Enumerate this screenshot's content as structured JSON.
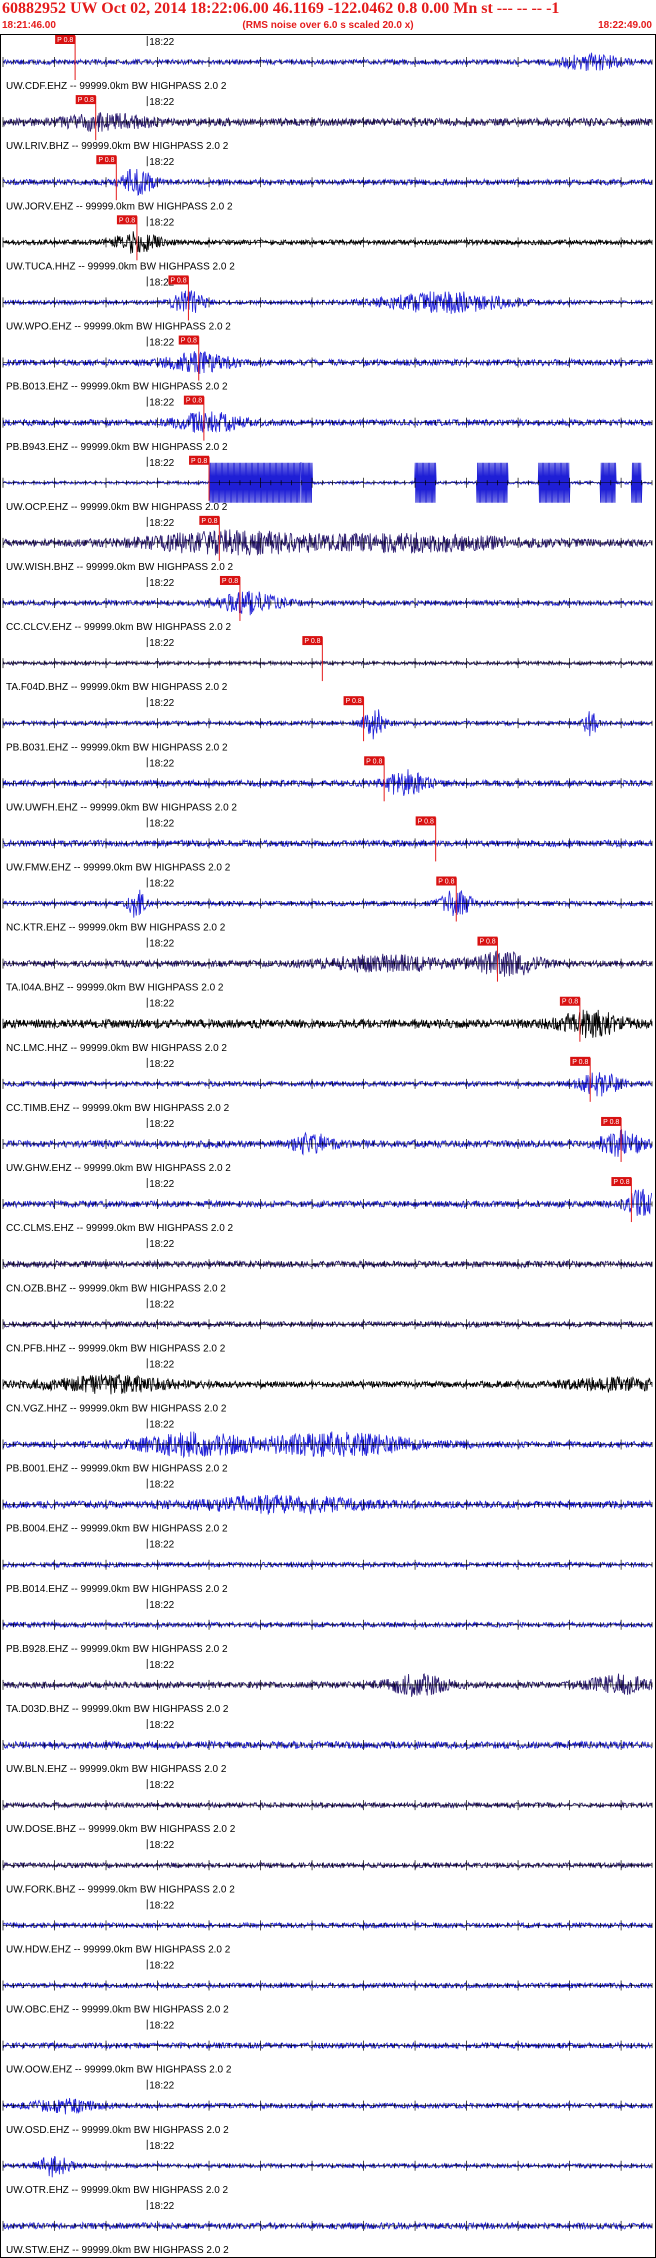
{
  "header": {
    "title": "60882952 UW Oct 02, 2014 18:22:06.00   46.1169 -122.0462  0.8 0.00 Mn st --- -- --  -1",
    "start_time": "18:21:46.00",
    "scale_note": "(RMS noise over 6.0 s scaled 20.0 x)",
    "end_time": "18:22:49.00"
  },
  "chart_data": {
    "type": "line",
    "time_start": "18:21:46.00",
    "time_end": "18:22:49.00",
    "minute_label": "18:22",
    "grid": false,
    "traces": [
      {
        "label": "UW.CDF.EHZ -- 99999.0km BW  HIGHPASS  2.0  2",
        "color": "#1f1fd6",
        "pick": "18:21:53.0",
        "pick_label": "P 0.8",
        "amp": 0.35,
        "bursts": [
          {
            "t": 57,
            "a": 1.0,
            "w": 3
          }
        ]
      },
      {
        "label": "UW.LRIV.BHZ -- 99999.0km BW  HIGHPASS  2.0  2",
        "color": "#2a1a6e",
        "pick": "18:21:55.0",
        "pick_label": "P 0.8",
        "amp": 0.55,
        "bursts": [
          {
            "t": 10,
            "a": 0.9,
            "w": 4
          }
        ]
      },
      {
        "label": "UW.JORV.EHZ -- 99999.0km BW  HIGHPASS  2.0  2",
        "color": "#1f1fd6",
        "pick": "18:21:57.0",
        "pick_label": "P 0.8",
        "amp": 0.4,
        "bursts": [
          {
            "t": 13,
            "a": 1.8,
            "w": 1.5
          }
        ]
      },
      {
        "label": "UW.TUCA.HHZ -- 99999.0km BW  HIGHPASS  2.0  2",
        "color": "#000000",
        "pick": "18:21:59.0",
        "pick_label": "P 0.8",
        "amp": 0.35,
        "bursts": [
          {
            "t": 13,
            "a": 1.5,
            "w": 2
          }
        ]
      },
      {
        "label": "UW.WPO.EHZ -- 99999.0km BW  HIGHPASS  2.0  2",
        "color": "#1f1fd6",
        "pick": "18:22:04.0",
        "pick_label": "P 0.8",
        "amp": 0.3,
        "bursts": [
          {
            "t": 18,
            "a": 1.6,
            "w": 1.5
          },
          {
            "t": 43,
            "a": 1.4,
            "w": 6
          }
        ]
      },
      {
        "label": "PB.B013.EHZ -- 99999.0km BW  HIGHPASS  2.0  2",
        "color": "#1f1fd6",
        "pick": "18:22:05.0",
        "pick_label": "P 0.8",
        "amp": 0.45,
        "bursts": [
          {
            "t": 19,
            "a": 1.2,
            "w": 3
          }
        ]
      },
      {
        "label": "PB.B943.EHZ -- 99999.0km BW  HIGHPASS  2.0  2",
        "color": "#1f1fd6",
        "pick": "18:22:05.5",
        "pick_label": "P 0.8",
        "amp": 0.45,
        "bursts": [
          {
            "t": 20,
            "a": 1.3,
            "w": 3
          }
        ]
      },
      {
        "label": "UW.OCP.EHZ -- 99999.0km BW  HIGHPASS  2.0  2",
        "color": "#1f1fd6",
        "pick": "18:22:06.0",
        "pick_label": "P 0.8",
        "amp": 0.2,
        "bursts": [],
        "clipped": [
          [
            20,
            30
          ],
          [
            40,
            42
          ],
          [
            46,
            49
          ],
          [
            52,
            55
          ],
          [
            58,
            59.5
          ],
          [
            61,
            62
          ]
        ]
      },
      {
        "label": "UW.WISH.BHZ -- 99999.0km BW  HIGHPASS  2.0  2",
        "color": "#2a1a6e",
        "pick": "18:22:07.0",
        "pick_label": "P 0.8",
        "amp": 0.5,
        "bursts": [
          {
            "t": 22,
            "a": 1.4,
            "w": 8
          },
          {
            "t": 40,
            "a": 1.0,
            "w": 10
          }
        ]
      },
      {
        "label": "CC.CLCV.EHZ -- 99999.0km BW  HIGHPASS  2.0  2",
        "color": "#1f1fd6",
        "pick": "18:22:09.0",
        "pick_label": "P 0.8",
        "amp": 0.35,
        "bursts": [
          {
            "t": 24,
            "a": 1.4,
            "w": 3
          }
        ]
      },
      {
        "label": "TA.F04D.BHZ -- 99999.0km BW  HIGHPASS  2.0  2",
        "color": "#2a1a6e",
        "pick": "18:22:17.0",
        "pick_label": "P 0.8",
        "amp": 0.25,
        "bursts": []
      },
      {
        "label": "PB.B031.EHZ -- 99999.0km BW  HIGHPASS  2.0  2",
        "color": "#1f1fd6",
        "pick": "18:22:21.0",
        "pick_label": "P 0.8",
        "amp": 0.3,
        "bursts": [
          {
            "t": 36,
            "a": 2.2,
            "w": 1
          },
          {
            "t": 57,
            "a": 2.0,
            "w": 0.6
          }
        ]
      },
      {
        "label": "UW.UWFH.EHZ -- 99999.0km BW  HIGHPASS  2.0  2",
        "color": "#1f1fd6",
        "pick": "18:22:23.0",
        "pick_label": "P 0.8",
        "amp": 0.45,
        "bursts": [
          {
            "t": 39,
            "a": 1.6,
            "w": 2
          }
        ]
      },
      {
        "label": "UW.FMW.EHZ -- 99999.0km BW  HIGHPASS  2.0  2",
        "color": "#1f1fd6",
        "pick": "18:22:28.0",
        "pick_label": "P 0.8",
        "amp": 0.45,
        "bursts": []
      },
      {
        "label": "NC.KTR.EHZ -- 99999.0km BW  HIGHPASS  2.0  2",
        "color": "#1f1fd6",
        "pick": "18:22:30.0",
        "pick_label": "P 0.8",
        "amp": 0.35,
        "bursts": [
          {
            "t": 13,
            "a": 2.0,
            "w": 0.8
          },
          {
            "t": 44,
            "a": 1.8,
            "w": 1.5
          }
        ]
      },
      {
        "label": "TA.I04A.BHZ -- 99999.0km BW  HIGHPASS  2.0  2",
        "color": "#2a1a6e",
        "pick": "18:22:34.0",
        "pick_label": "P 0.8",
        "amp": 0.45,
        "bursts": [
          {
            "t": 37,
            "a": 1.0,
            "w": 6
          },
          {
            "t": 49,
            "a": 1.6,
            "w": 3
          }
        ]
      },
      {
        "label": "NC.LMC.HHZ -- 99999.0km BW  HIGHPASS  2.0  2",
        "color": "#000000",
        "pick": "18:22:42.0",
        "pick_label": "P 0.8",
        "amp": 0.6,
        "bursts": [
          {
            "t": 57,
            "a": 1.5,
            "w": 3
          }
        ]
      },
      {
        "label": "CC.TIMB.EHZ -- 99999.0km BW  HIGHPASS  2.0  2",
        "color": "#1f1fd6",
        "pick": "18:22:43.0",
        "pick_label": "P 0.8",
        "amp": 0.35,
        "bursts": [
          {
            "t": 58,
            "a": 1.5,
            "w": 2
          }
        ]
      },
      {
        "label": "UW.GHW.EHZ -- 99999.0km BW  HIGHPASS  2.0  2",
        "color": "#1f1fd6",
        "pick": "18:22:46.0",
        "pick_label": "P 0.8",
        "amp": 0.5,
        "bursts": [
          {
            "t": 30,
            "a": 1.2,
            "w": 2
          },
          {
            "t": 60,
            "a": 1.6,
            "w": 2
          }
        ]
      },
      {
        "label": "CC.CLMS.EHZ -- 99999.0km BW  HIGHPASS  2.0  2",
        "color": "#1f1fd6",
        "pick": "18:22:47.0",
        "pick_label": "P 0.8",
        "amp": 0.45,
        "bursts": [
          {
            "t": 62,
            "a": 1.8,
            "w": 1.5
          }
        ]
      },
      {
        "label": "CN.OZB.BHZ -- 99999.0km BW  HIGHPASS  2.0  2",
        "color": "#2a1a6e",
        "pick": null,
        "amp": 0.45,
        "bursts": []
      },
      {
        "label": "CN.PFB.HHZ -- 99999.0km BW  HIGHPASS  2.0  2",
        "color": "#2a1a6e",
        "pick": null,
        "amp": 0.4,
        "bursts": []
      },
      {
        "label": "CN.VGZ.HHZ -- 99999.0km BW  HIGHPASS  2.0  2",
        "color": "#000000",
        "pick": null,
        "amp": 0.45,
        "bursts": [
          {
            "t": 10,
            "a": 1.0,
            "w": 6
          },
          {
            "t": 60,
            "a": 0.8,
            "w": 5
          }
        ]
      },
      {
        "label": "PB.B001.EHZ -- 99999.0km BW  HIGHPASS  2.0  2",
        "color": "#1f1fd6",
        "pick": null,
        "amp": 0.45,
        "bursts": [
          {
            "t": 18,
            "a": 1.4,
            "w": 5
          },
          {
            "t": 32,
            "a": 1.4,
            "w": 8
          }
        ]
      },
      {
        "label": "PB.B004.EHZ -- 99999.0km BW  HIGHPASS  2.0  2",
        "color": "#1f1fd6",
        "pick": null,
        "amp": 0.5,
        "bursts": [
          {
            "t": 27,
            "a": 1.0,
            "w": 8
          }
        ]
      },
      {
        "label": "PB.B014.EHZ -- 99999.0km BW  HIGHPASS  2.0  2",
        "color": "#1f1fd6",
        "pick": null,
        "amp": 0.35,
        "bursts": []
      },
      {
        "label": "PB.B928.EHZ -- 99999.0km BW  HIGHPASS  2.0  2",
        "color": "#1f1fd6",
        "pick": null,
        "amp": 0.35,
        "bursts": []
      },
      {
        "label": "TA.D03D.BHZ -- 99999.0km BW  HIGHPASS  2.0  2",
        "color": "#2a1a6e",
        "pick": null,
        "amp": 0.45,
        "bursts": [
          {
            "t": 40,
            "a": 1.3,
            "w": 3
          },
          {
            "t": 60,
            "a": 1.2,
            "w": 3
          }
        ]
      },
      {
        "label": "UW.BLN.EHZ -- 99999.0km BW  HIGHPASS  2.0  2",
        "color": "#1f1fd6",
        "pick": null,
        "amp": 0.5,
        "bursts": []
      },
      {
        "label": "UW.DOSE.BHZ -- 99999.0km BW  HIGHPASS  2.0  2",
        "color": "#2a1a6e",
        "pick": null,
        "amp": 0.35,
        "bursts": []
      },
      {
        "label": "UW.FORK.BHZ -- 99999.0km BW  HIGHPASS  2.0  2",
        "color": "#2a1a6e",
        "pick": null,
        "amp": 0.35,
        "bursts": []
      },
      {
        "label": "UW.HDW.EHZ -- 99999.0km BW  HIGHPASS  2.0  2",
        "color": "#1f1fd6",
        "pick": null,
        "amp": 0.35,
        "bursts": []
      },
      {
        "label": "UW.OBC.EHZ -- 99999.0km BW  HIGHPASS  2.0  2",
        "color": "#1f1fd6",
        "pick": null,
        "amp": 0.35,
        "bursts": []
      },
      {
        "label": "UW.OOW.EHZ -- 99999.0km BW  HIGHPASS  2.0  2",
        "color": "#1f1fd6",
        "pick": null,
        "amp": 0.4,
        "bursts": []
      },
      {
        "label": "UW.OSD.EHZ -- 99999.0km BW  HIGHPASS  2.0  2",
        "color": "#1f1fd6",
        "pick": null,
        "amp": 0.35,
        "bursts": [
          {
            "t": 6,
            "a": 0.9,
            "w": 3
          }
        ]
      },
      {
        "label": "UW.OTR.EHZ -- 99999.0km BW  HIGHPASS  2.0  2",
        "color": "#1f1fd6",
        "pick": null,
        "amp": 0.3,
        "bursts": [
          {
            "t": 5,
            "a": 1.5,
            "w": 1.5
          }
        ]
      },
      {
        "label": "UW.STW.EHZ -- 99999.0km BW  HIGHPASS  2.0  2",
        "color": "#1f1fd6",
        "pick": null,
        "amp": 0.45,
        "bursts": []
      }
    ]
  }
}
